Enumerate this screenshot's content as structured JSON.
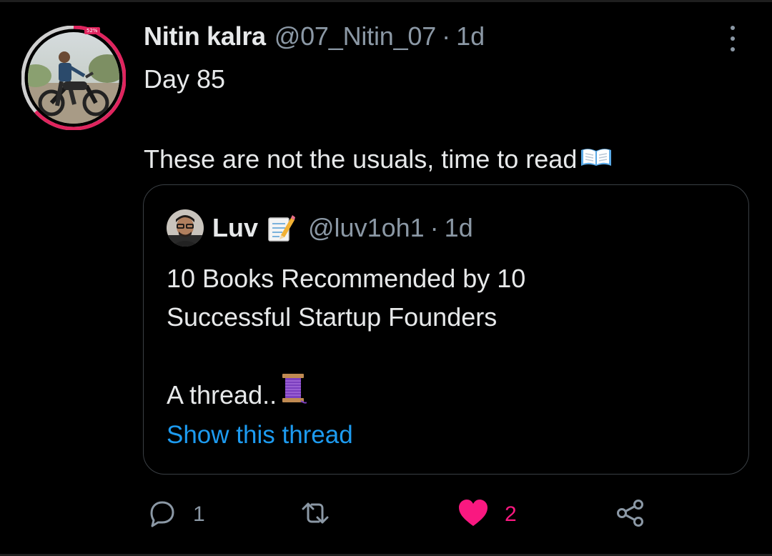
{
  "tweet": {
    "author_name": "Nitin kalra",
    "author_handle": "@07_Nitin_07",
    "separator": "·",
    "timestamp": "1d",
    "avatar_badge": "52%",
    "text": "Day 85\n\nThese are not the usuals, time to read",
    "text_emoji_icon": "open-book-icon"
  },
  "quoted_tweet": {
    "author_name": "Luv",
    "name_emoji_icon": "memo-pencil-icon",
    "author_handle": "@luv1oh1",
    "separator": "·",
    "timestamp": "1d",
    "text_line_1": "10 Books Recommended by 10",
    "text_line_2": "Successful Startup Founders",
    "text_line_3": "A thread..",
    "text_emoji_icon": "spool-of-thread-icon",
    "show_thread_label": "Show this thread"
  },
  "actions": {
    "reply_count": "1",
    "retweet_count": "",
    "like_count": "2",
    "liked": true
  },
  "colors": {
    "background": "#000000",
    "primary_text": "#e7e9ea",
    "secondary_text": "#8b98a5",
    "link": "#1d9bf0",
    "like": "#f91880",
    "ring": "#e0245e",
    "border": "#3a3f44"
  }
}
